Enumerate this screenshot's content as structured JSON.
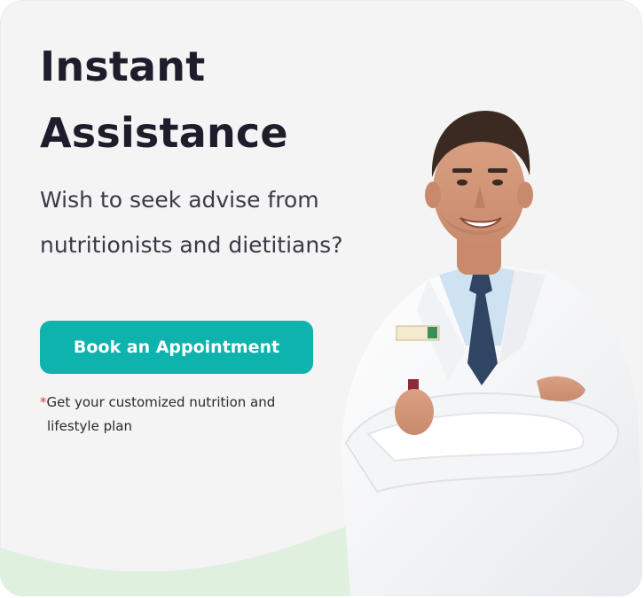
{
  "card": {
    "title_line1": "Instant",
    "title_line2": "Assistance",
    "subtitle_line1": "Wish to seek advise from",
    "subtitle_line2": "nutritionists and dietitians?",
    "button_label": "Book an Appointment",
    "note_asterisk": "*",
    "note_line1": "Get your customized nutrition and",
    "note_line2": "lifestyle plan"
  },
  "colors": {
    "card_background": "#f4f4f5",
    "title": "#1f1d2b",
    "button": "#0fb3ad",
    "button_text": "#ffffff",
    "asterisk": "#e53935",
    "wave": "#dff0df"
  },
  "illustration": {
    "subject": "smiling doctor in white lab coat with arms crossed"
  }
}
